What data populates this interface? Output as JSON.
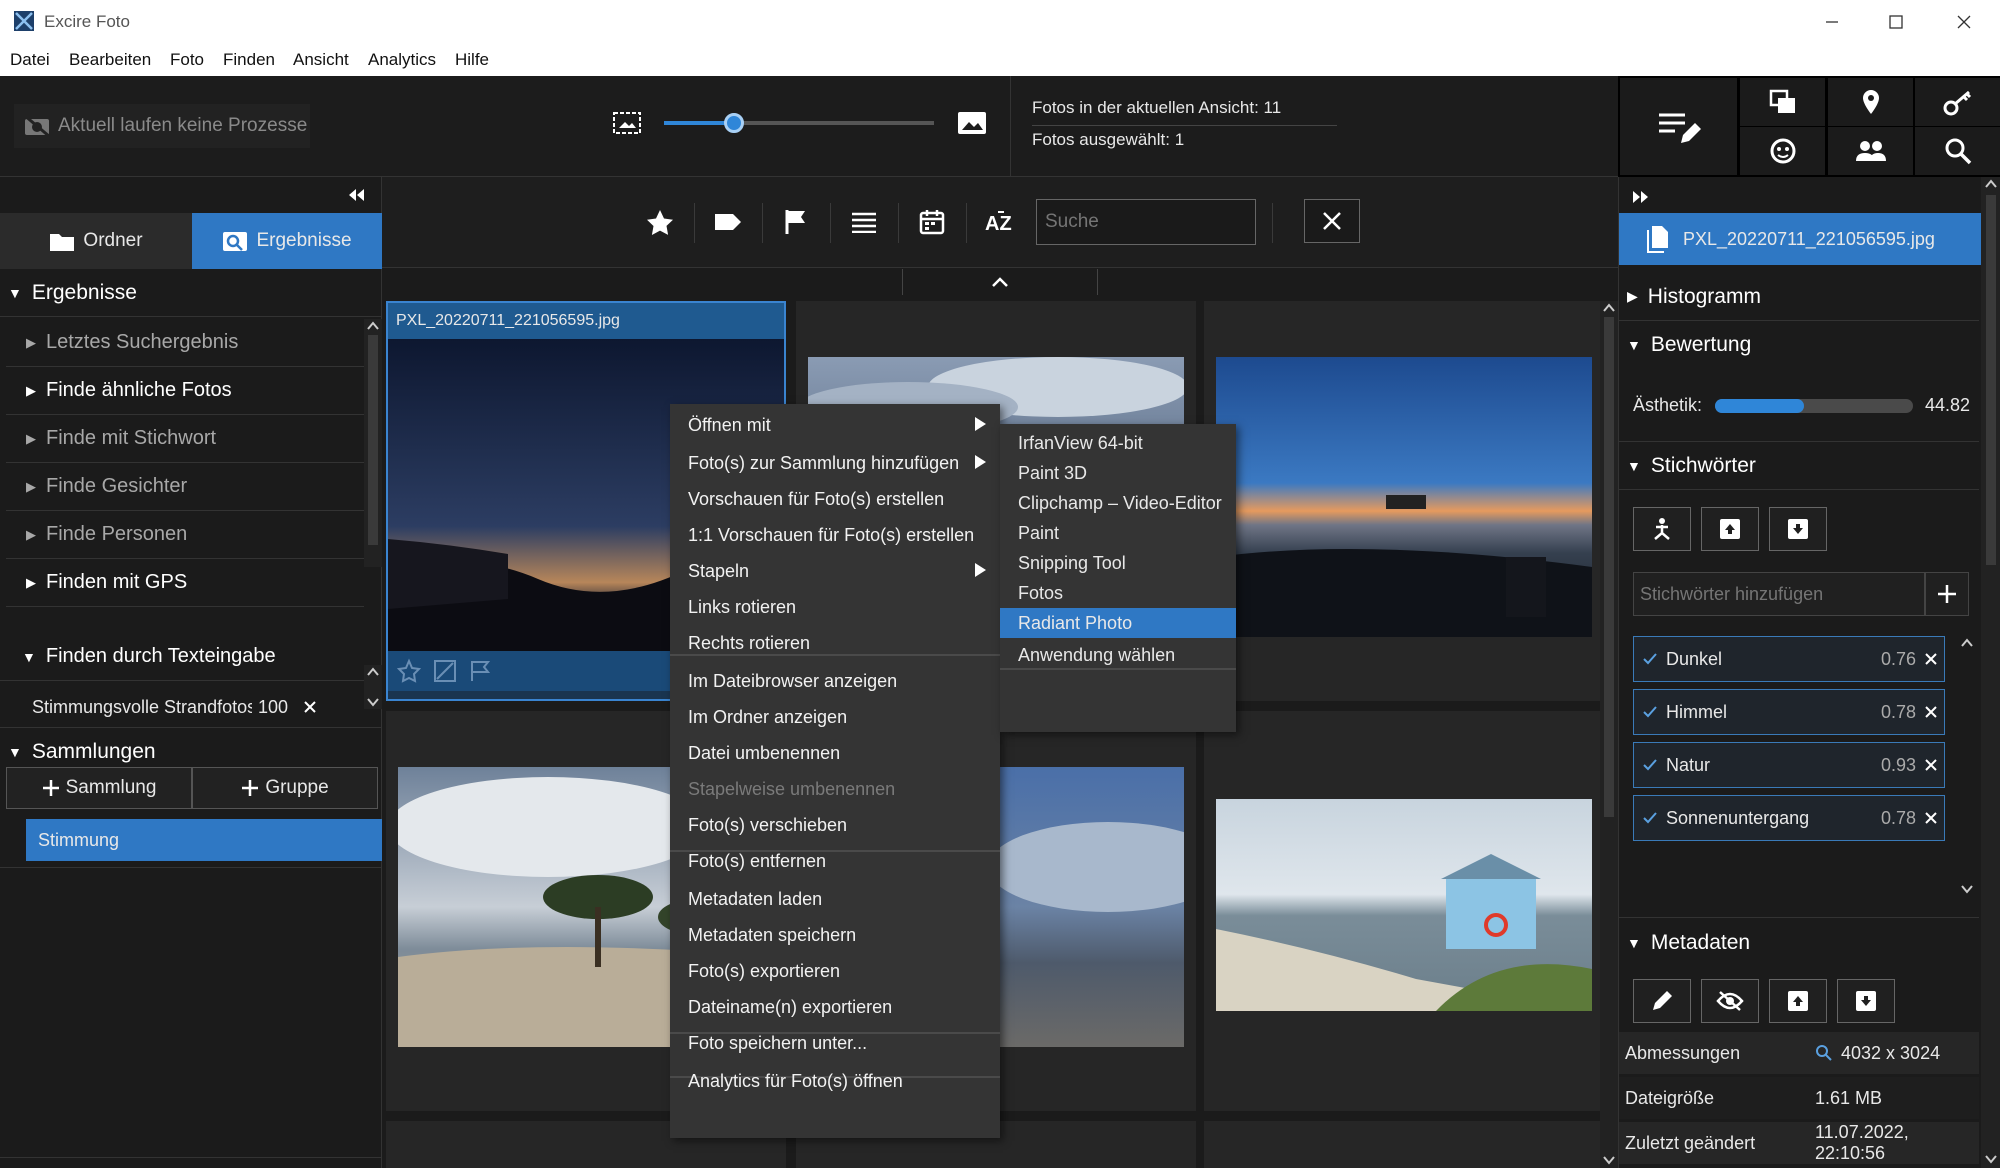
{
  "app": {
    "title": "Excire Foto"
  },
  "menu": [
    "Datei",
    "Bearbeiten",
    "Foto",
    "Finden",
    "Ansicht",
    "Analytics",
    "Hilfe"
  ],
  "toolbar": {
    "process_status": "Aktuell laufen keine Prozesse",
    "zoom_level": 0.26,
    "count_view": "Fotos in der aktuellen Ansicht: 11",
    "count_selected": "Fotos ausgewählt: 1"
  },
  "left": {
    "tab_folder": "Ordner",
    "tab_results": "Ergebnisse",
    "results_header": "Ergebnisse",
    "items": [
      {
        "label": "Letztes Suchergebnis",
        "bright": false
      },
      {
        "label": "Finde ähnliche Fotos",
        "bright": true
      },
      {
        "label": "Finde mit Stichwort",
        "bright": false
      },
      {
        "label": "Finde Gesichter",
        "bright": false
      },
      {
        "label": "Finde Personen",
        "bright": false
      },
      {
        "label": "Finden mit GPS",
        "bright": true
      }
    ],
    "text_search_header": "Finden durch Texteingabe",
    "search_entry": {
      "label": "Stimmungsvolle Strandfotos ...",
      "count": "100"
    },
    "collections_header": "Sammlungen",
    "add_collection": "Sammlung",
    "add_group": "Gruppe",
    "collection_item": "Stimmung"
  },
  "filter": {
    "search_placeholder": "Suche"
  },
  "grid": {
    "selected_filename": "PXL_20220711_221056595.jpg"
  },
  "context_menu": {
    "items": [
      "Öffnen mit",
      "Foto(s) zur Sammlung hinzufügen",
      "Vorschauen für Foto(s) erstellen",
      "1:1 Vorschauen für Foto(s) erstellen",
      "Stapeln",
      "Links rotieren",
      "Rechts rotieren",
      "Im Dateibrowser anzeigen",
      "Im Ordner anzeigen",
      "Datei umbenennen",
      "Stapelweise umbenennen",
      "Foto(s) verschieben",
      "Foto(s) entfernen",
      "Metadaten laden",
      "Metadaten speichern",
      "Foto(s) exportieren",
      "Dateiname(n) exportieren",
      "Foto speichern unter...",
      "Analytics für Foto(s) öffnen"
    ],
    "submenu": [
      "IrfanView 64-bit",
      "Paint 3D",
      "Clipchamp – Video-Editor",
      "Paint",
      "Snipping Tool",
      "Fotos",
      "Radiant Photo",
      "Anwendung wählen"
    ]
  },
  "right": {
    "filename": "PXL_20220711_221056595.jpg",
    "histogram": "Histogramm",
    "rating_header": "Bewertung",
    "aesthetic_label": "Ästhetik:",
    "aesthetic_value": "44.82",
    "aesthetic_fraction": 0.45,
    "keywords_header": "Stichwörter",
    "keyword_placeholder": "Stichwörter hinzufügen",
    "keywords": [
      {
        "name": "Dunkel",
        "score": "0.76"
      },
      {
        "name": "Himmel",
        "score": "0.78"
      },
      {
        "name": "Natur",
        "score": "0.93"
      },
      {
        "name": "Sonnenuntergang",
        "score": "0.78"
      }
    ],
    "metadata_header": "Metadaten",
    "metadata": [
      {
        "key": "Abmessungen",
        "value": "4032 x 3024"
      },
      {
        "key": "Dateigröße",
        "value": "1.61 MB"
      },
      {
        "key": "Zuletzt geändert",
        "value": "11.07.2022, 22:10:56"
      }
    ]
  },
  "colors": {
    "accent": "#2f78c4",
    "highlight": "#3a84d0",
    "panel": "#1b1b1b"
  }
}
